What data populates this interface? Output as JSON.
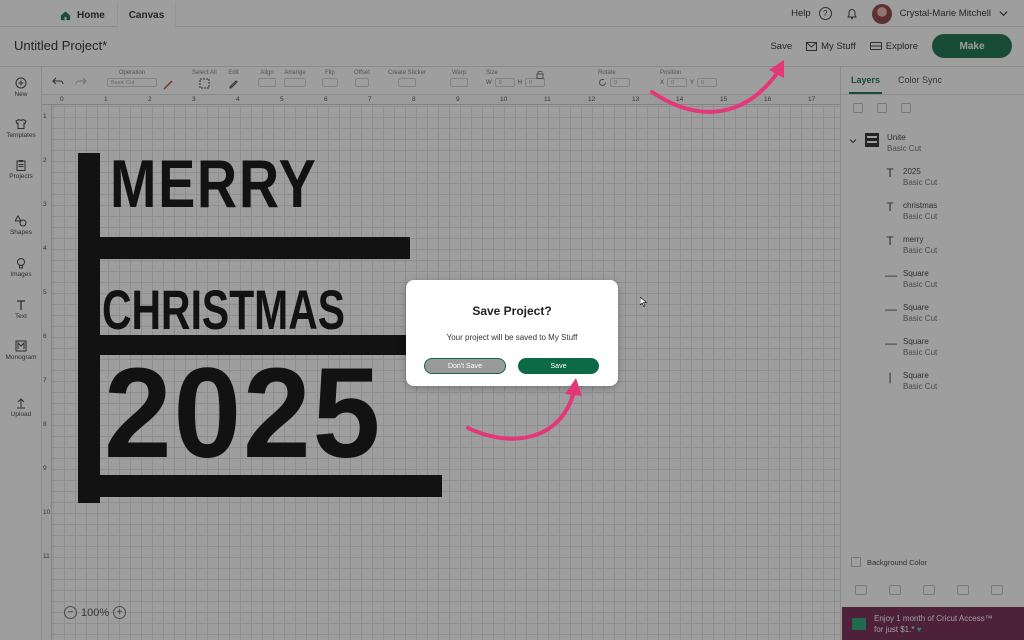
{
  "topbar": {
    "home_tab": "Home",
    "canvas_tab": "Canvas",
    "help": "Help",
    "help_icon": "question-icon",
    "user_name": "Crystal-Marie Mitchell"
  },
  "project": {
    "title": "Untitled Project*",
    "save": "Save",
    "my_stuff": "My Stuff",
    "explore": "Explore",
    "make": "Make"
  },
  "sidebar": {
    "items": [
      {
        "label": "New",
        "icon": "plus-circle-icon"
      },
      {
        "label": "Templates",
        "icon": "shirt-icon"
      },
      {
        "label": "Projects",
        "icon": "clipboard-icon"
      },
      {
        "label": "Shapes",
        "icon": "shapes-icon"
      },
      {
        "label": "Images",
        "icon": "lightbulb-icon"
      },
      {
        "label": "Text",
        "icon": "text-icon"
      },
      {
        "label": "Monogram",
        "icon": "monogram-icon"
      },
      {
        "label": "Upload",
        "icon": "upload-icon"
      }
    ]
  },
  "toolbar": {
    "operation": "Operation",
    "operation_value": "Basic Cut",
    "select_all": "Select All",
    "edit": "Edit",
    "align": "Align",
    "arrange": "Arrange",
    "flip": "Flip",
    "offset": "Offset",
    "create_sticker": "Create Sticker",
    "warp": "Warp",
    "size": "Size",
    "size_w": "W",
    "size_h": "H",
    "rotate": "Rotate",
    "position": "Position",
    "position_x": "X",
    "position_y": "Y",
    "field_value": "0"
  },
  "rulers": {
    "top": [
      "0",
      "1",
      "2",
      "3",
      "4",
      "5",
      "6",
      "7",
      "8",
      "9",
      "10",
      "11",
      "12",
      "13",
      "14",
      "15",
      "16",
      "17"
    ],
    "left": [
      "1",
      "2",
      "3",
      "4",
      "5",
      "6",
      "7",
      "8",
      "9",
      "10",
      "11"
    ]
  },
  "design": {
    "line1": "MERRY",
    "line2": "CHRISTMAS",
    "line3": "2025"
  },
  "zoom": {
    "minus": "−",
    "level": "100%",
    "plus": "+"
  },
  "layers_panel": {
    "tab_layers": "Layers",
    "tab_color_sync": "Color Sync",
    "group_name": "Unite",
    "group_op": "Basic Cut",
    "items": [
      {
        "name": "2025",
        "op": "Basic Cut",
        "glyph": "T"
      },
      {
        "name": "christmas",
        "op": "Basic Cut",
        "glyph": "T"
      },
      {
        "name": "merry",
        "op": "Basic Cut",
        "glyph": "T"
      },
      {
        "name": "Square",
        "op": "Basic Cut",
        "glyph": "—"
      },
      {
        "name": "Square",
        "op": "Basic Cut",
        "glyph": "—"
      },
      {
        "name": "Square",
        "op": "Basic Cut",
        "glyph": "—"
      },
      {
        "name": "Square",
        "op": "Basic Cut",
        "glyph": "|"
      }
    ],
    "background_color": "Background Color"
  },
  "promo": {
    "line1": "Enjoy 1 month of Cricut Access™",
    "line2": "for just $1.*",
    "heart": "♥"
  },
  "modal": {
    "title": "Save Project?",
    "message": "Your project will be saved to My Stuff",
    "dont_save": "Don't Save",
    "save": "Save"
  },
  "colors": {
    "brand_green": "#0d6a46",
    "annotation_pink": "#e5367a",
    "promo_bg": "#6d1c4a"
  }
}
